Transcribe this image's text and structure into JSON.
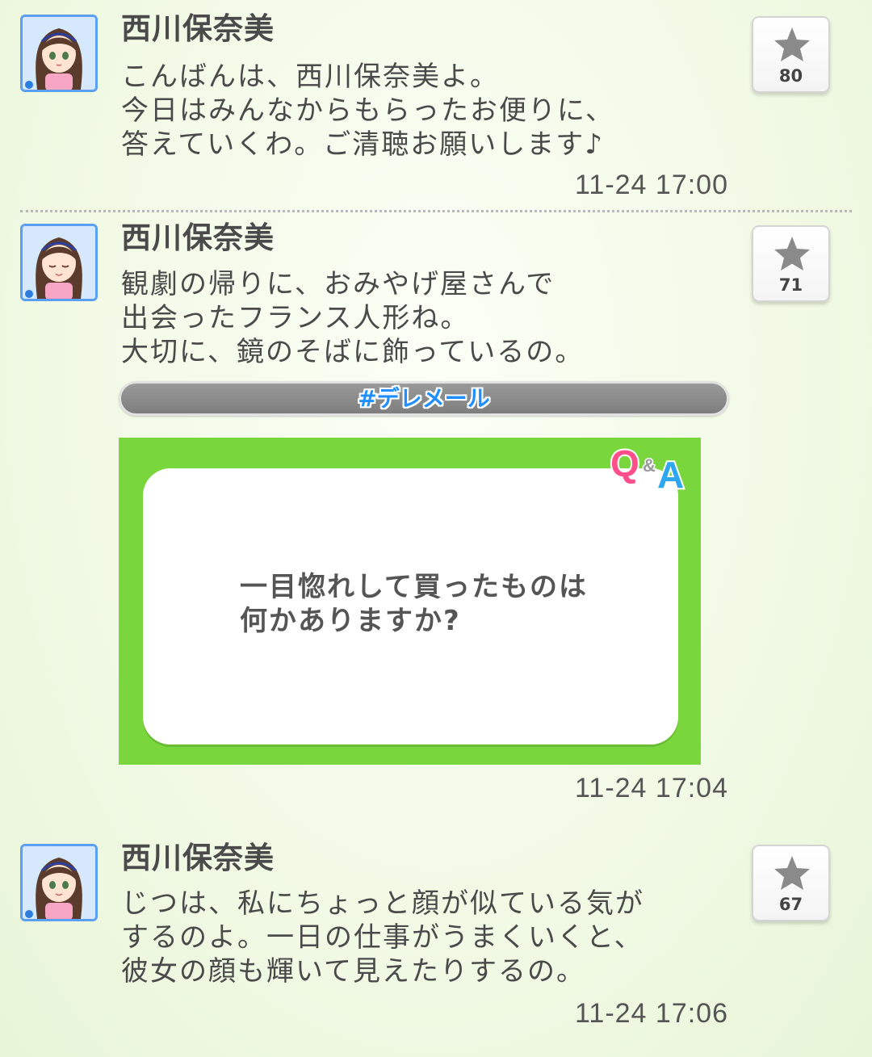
{
  "posts": [
    {
      "author": "西川保奈美",
      "message": "こんばんは、西川保奈美よ。\n今日はみんなからもらったお便りに、\n答えていくわ。ご清聴お願いします♪",
      "timestamp": "11-24 17:00",
      "favorite_count": "80"
    },
    {
      "author": "西川保奈美",
      "message": "観劇の帰りに、おみやげ屋さんで\n出会ったフランス人形ね。\n大切に、鏡のそばに飾っているの。",
      "hashtag": "#デレメール",
      "qa_card": {
        "logo_q": "Q",
        "logo_amp": "&",
        "logo_a": "A",
        "question": "一目惚れして買ったものは\n何かありますか?"
      },
      "timestamp": "11-24 17:04",
      "favorite_count": "71"
    },
    {
      "author": "西川保奈美",
      "message": "じつは、私にちょっと顔が似ている気が\nするのよ。一日の仕事がうまくいくと、\n彼女の顔も輝いて見えたりするの。",
      "timestamp": "11-24 17:06",
      "favorite_count": "67"
    }
  ],
  "colors": {
    "avatar_border": "#5b9ff0",
    "hashtag_text": "#1f8fff",
    "qa_card_bg": "#79d63c",
    "star": "#8a8a8a"
  },
  "icons": {
    "favorite": "star-icon",
    "avatar": "character-avatar-icon"
  }
}
